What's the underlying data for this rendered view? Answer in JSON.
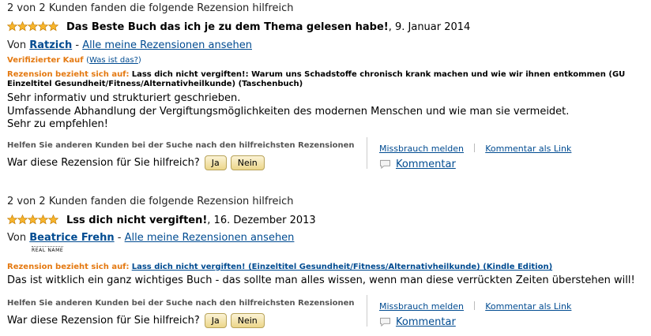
{
  "reviews": [
    {
      "helpful_count": "2 von 2 Kunden fanden die folgende Rezension hilfreich",
      "rating": 5,
      "title": "Das Beste Buch das ich je zu dem Thema gelesen habe!",
      "date": ", 9. Januar 2014",
      "by_prefix": "Von",
      "author": "Ratzich",
      "separator": "-",
      "all_reviews_link": "Alle meine Rezensionen ansehen",
      "verified_label": "Verifizierter Kauf",
      "verified_help": "Was ist das?",
      "product_label": "Rezension bezieht sich auf:",
      "product_name": "Lass dich nicht vergiften!: Warum uns Schadstoffe chronisch krank machen und wie wir ihnen entkommen (GU Einzeltitel Gesundheit/Fitness/Alternativheilkunde) (Taschenbuch)",
      "body_lines": [
        "Sehr informativ und strukturiert geschrieben.",
        "Umfassende Abhandlung der Vergiftungsmöglichkeiten des modernen Menschen und wie man sie vermeidet.",
        "Sehr zu empfehlen!"
      ]
    },
    {
      "helpful_count": "2 von 2 Kunden fanden die folgende Rezension hilfreich",
      "rating": 5,
      "title": "Lss dich nicht vergiften!",
      "date": ", 16. Dezember 2013",
      "by_prefix": "Von",
      "author": "Beatrice Frehn",
      "separator": "-",
      "all_reviews_link": "Alle meine Rezensionen ansehen",
      "real_name_badge": "REAL NAME",
      "product_label": "Rezension bezieht sich auf:",
      "product_name": "Lass dich nicht vergiften! (Einzeltitel Gesundheit/Fitness/Alternativheilkunde) (Kindle Edition)",
      "body_lines": [
        "Das ist witklich ein ganz wichtiges Buch - das sollte man alles wissen, wenn man diese verrückten Zeiten überstehen will!"
      ]
    }
  ],
  "feedback": {
    "hint": "Helfen Sie anderen Kunden bei der Suche nach den hilfreichsten Rezensionen",
    "question": "War diese Rezension für Sie hilfreich?",
    "yes": "Ja",
    "no": "Nein",
    "report_abuse": "Missbrauch melden",
    "comment_as_link": "Kommentar als Link",
    "comment": "Kommentar"
  },
  "colors": {
    "star": "#f5a623",
    "link": "#004b91",
    "accent_orange": "#e47911"
  },
  "icons": [
    "star-icon",
    "comment-bubble-icon"
  ]
}
